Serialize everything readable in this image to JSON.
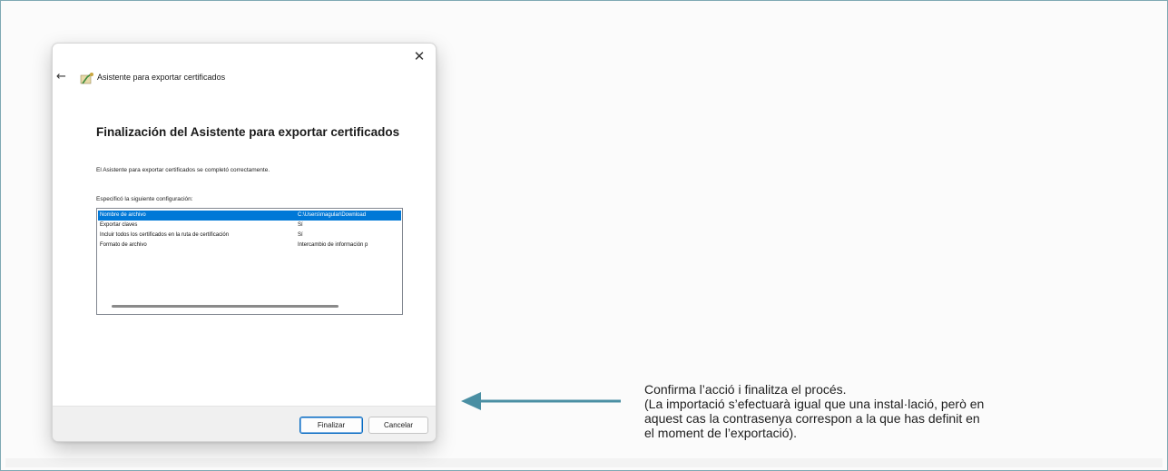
{
  "dialog": {
    "window_title": "Asistente para exportar certificados",
    "heading": "Finalización del Asistente para exportar certificados",
    "message": "El Asistente para exportar certificados se completó correctamente.",
    "config_label": "Especificó la siguiente configuración:",
    "settings": [
      {
        "name": "Nombre de archivo",
        "value": "C:\\Users\\magular\\Download",
        "selected": true
      },
      {
        "name": "Exportar claves",
        "value": "Sí",
        "selected": false
      },
      {
        "name": "Incluir todos los certificados en la ruta de certificación",
        "value": "Sí",
        "selected": false
      },
      {
        "name": "Formato de archivo",
        "value": "Intercambio de información p",
        "selected": false
      }
    ],
    "buttons": {
      "finish": "Finalizar",
      "cancel": "Cancelar"
    },
    "icons": {
      "close": "close-icon",
      "back": "back-arrow-icon",
      "wizard": "certificate-wizard-icon"
    }
  },
  "annotation": {
    "lines": [
      "Confirma l’acció i finalitza el procés.",
      "(La importació s’efectuarà igual que una instal·lació, però en",
      "aquest cas la contrasenya correspon a la que has definit en",
      "el moment de l’exportació)."
    ],
    "arrow_color": "#4a8fa3"
  },
  "colors": {
    "frame_border": "#7fa9b3",
    "selection": "#0078d7"
  }
}
